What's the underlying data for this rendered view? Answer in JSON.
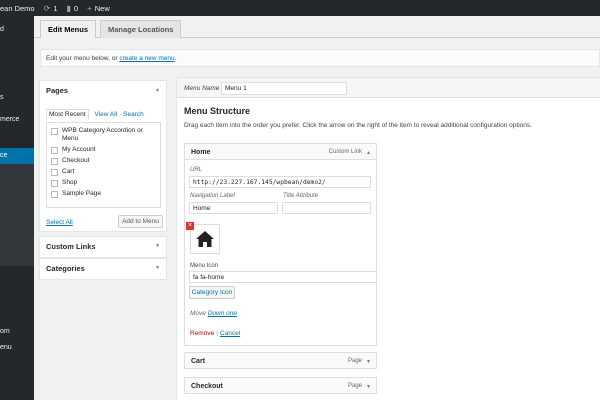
{
  "admin_bar": {
    "site_name": "ean Demo",
    "updates_count": "1",
    "comments_count": "0",
    "new_label": "New"
  },
  "admin_menu": {
    "items": [
      "d",
      "s",
      "merce",
      "ce",
      "om",
      "enu"
    ]
  },
  "tabs": [
    {
      "label": "Edit Menus",
      "active": true
    },
    {
      "label": "Manage Locations",
      "active": false
    }
  ],
  "manage_bar": {
    "text": "Edit your menu below, or ",
    "link": "create a new menu",
    "suffix": "."
  },
  "pages_box": {
    "title": "Pages",
    "tabs": [
      "Most Recent",
      "View All",
      "Search"
    ],
    "items": [
      "WPB Category Accordion or Menu",
      "My Account",
      "Checkout",
      "Cart",
      "Shop",
      "Sample Page"
    ],
    "select_all": "Select All",
    "add_button": "Add to Menu"
  },
  "custom_links_box": {
    "title": "Custom Links"
  },
  "categories_box": {
    "title": "Categories"
  },
  "menu": {
    "name_label": "Menu Name",
    "name_value": "Menu 1",
    "structure_title": "Menu Structure",
    "instructions": "Drag each item into the order you prefer. Click the arrow on the right of the item to reveal additional configuration options."
  },
  "home_item": {
    "title": "Home",
    "type": "Custom Link",
    "url_label": "URL",
    "url_value": "http://23.227.167.145/wpbean/demo2/",
    "nav_label": "Navigation Label",
    "nav_value": "Home",
    "title_attr_label": "Title Attribute",
    "title_attr_value": "",
    "menu_icon_label": "Menu Icon",
    "menu_icon_value": "fa fa-home",
    "category_icon_button": "Category Icon",
    "move_label": "Move",
    "move_link": "Down one",
    "remove_link": "Remove",
    "separator": "|",
    "cancel_link": "Cancel"
  },
  "other_items": [
    {
      "title": "Cart",
      "type": "Page"
    },
    {
      "title": "Checkout",
      "type": "Page"
    }
  ],
  "colors": {
    "admin_bg": "#23282d",
    "accent": "#0073aa",
    "remove": "#dc3232"
  }
}
